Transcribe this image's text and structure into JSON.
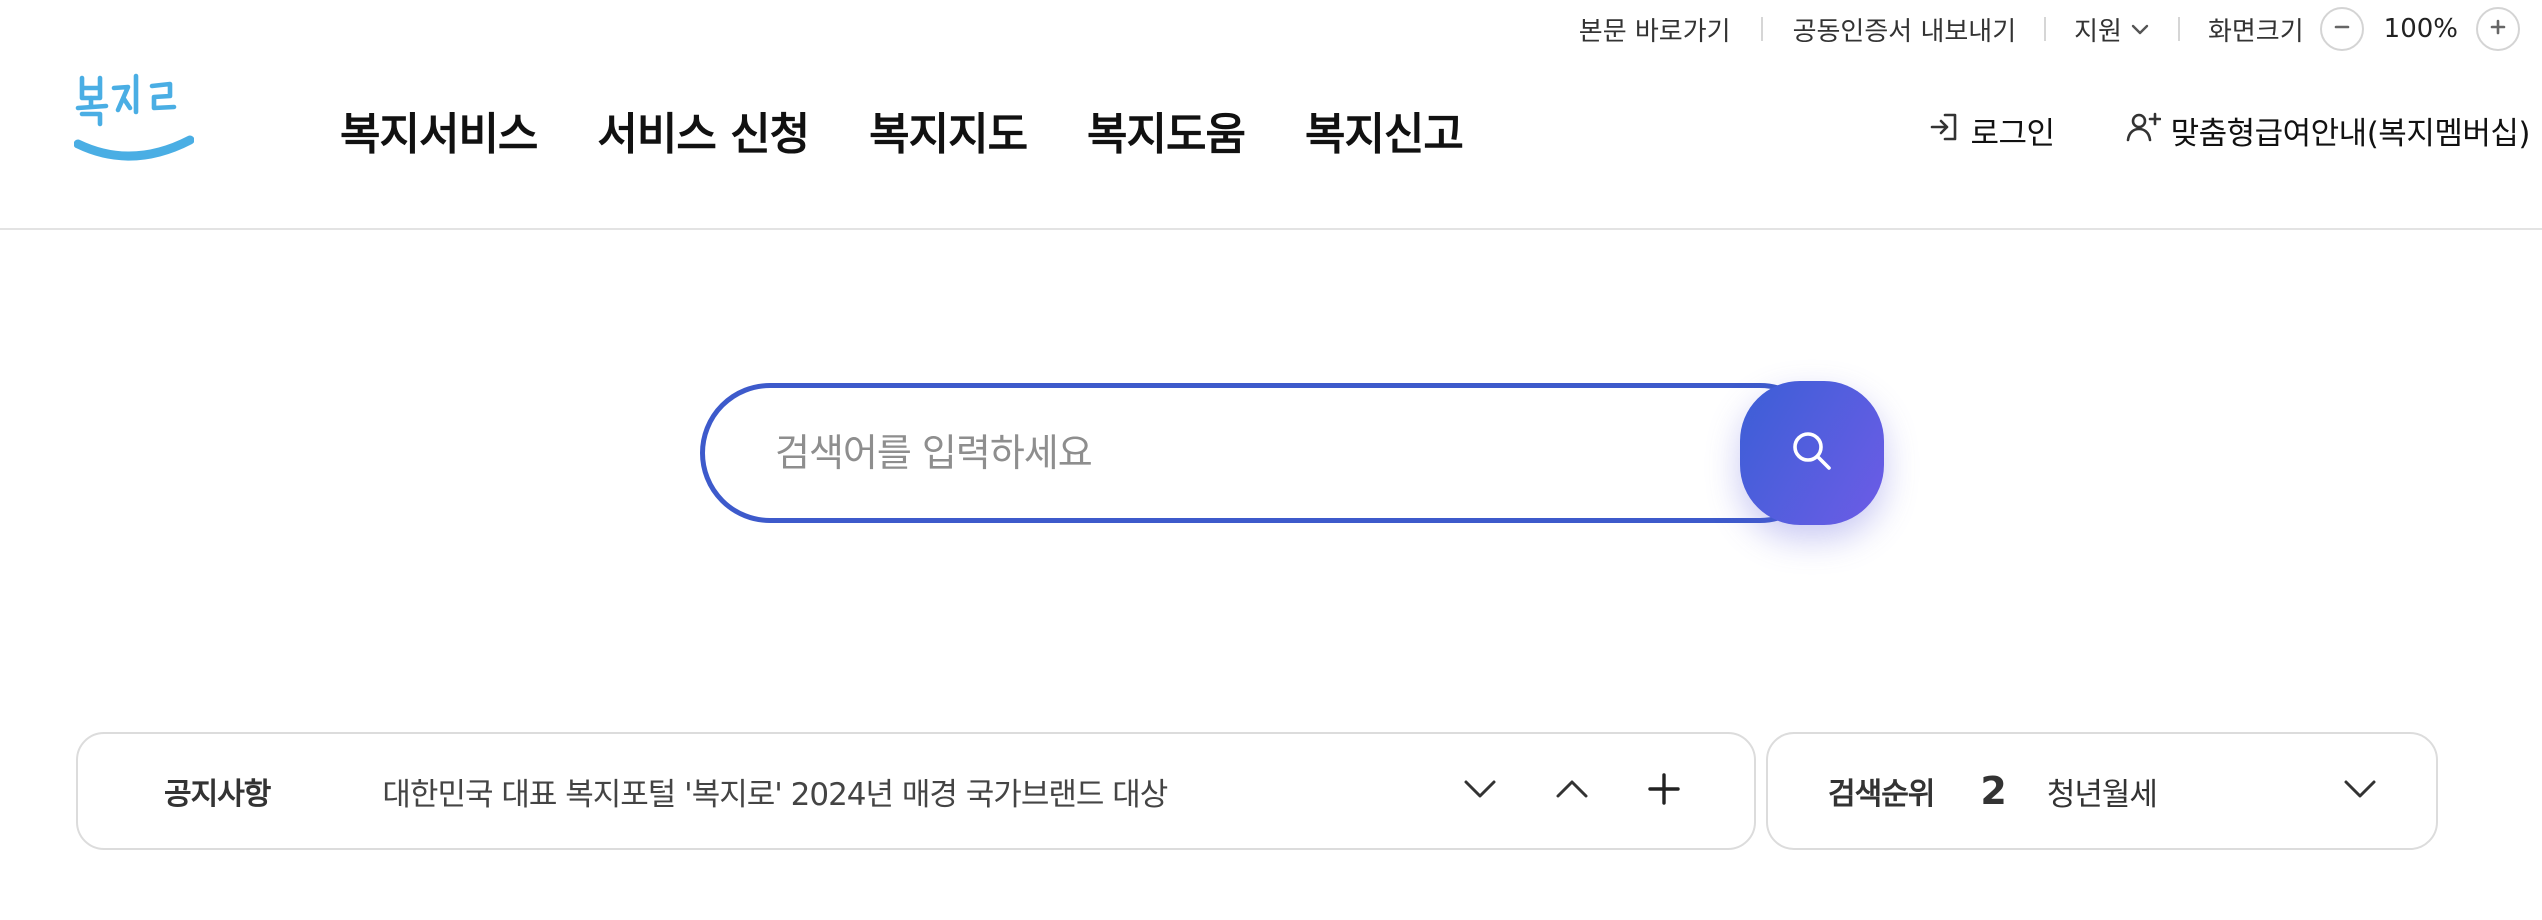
{
  "utility": {
    "skip_link": "본문 바로가기",
    "cert_export": "공동인증서 내보내기",
    "support": "지원",
    "zoom_label": "화면크기",
    "zoom_value": "100%"
  },
  "header": {
    "logo_text": "복지로",
    "nav": [
      "복지서비스",
      "서비스 신청",
      "복지지도",
      "복지도움",
      "복지신고"
    ],
    "login": "로그인",
    "membership": "맞춤형급여안내(복지멤버십)"
  },
  "search": {
    "placeholder": "검색어를 입력하세요",
    "value": ""
  },
  "notice": {
    "title": "공지사항",
    "text": "대한민국 대표 복지포털 '복지로' 2024년 매경 국가브랜드 대상"
  },
  "ranking": {
    "title": "검색순위",
    "number": "2",
    "keyword": "청년월세"
  },
  "colors": {
    "accent": "#3d5acb",
    "button_gradient_start": "#3b5fd6",
    "button_gradient_end": "#6d5ce6",
    "logo_blue": "#4aaee4"
  },
  "icons": [
    "chevron-down-icon",
    "minus-icon",
    "plus-icon",
    "login-icon",
    "user-plus-icon",
    "search-icon",
    "chevron-up-icon"
  ]
}
